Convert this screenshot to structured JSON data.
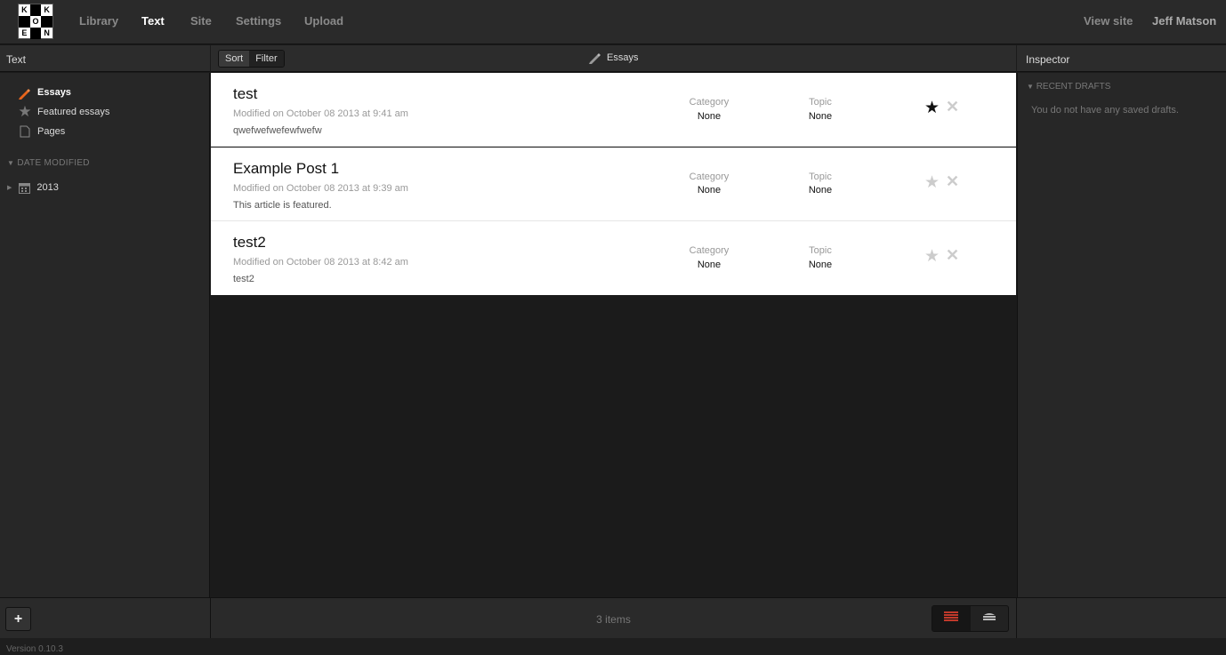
{
  "logo": {
    "letters": [
      "K",
      "",
      "K",
      "",
      "O",
      "",
      "E",
      "",
      "N"
    ]
  },
  "nav": {
    "library": "Library",
    "text": "Text",
    "site": "Site",
    "settings": "Settings",
    "upload": "Upload",
    "view_site": "View site",
    "user": "Jeff Matson"
  },
  "left_header": "Text",
  "sidebar": {
    "items": [
      {
        "label": "Essays",
        "icon": "pencil-icon"
      },
      {
        "label": "Featured essays",
        "icon": "star-icon"
      },
      {
        "label": "Pages",
        "icon": "page-icon"
      }
    ],
    "section_title": "DATE MODIFIED",
    "years": [
      {
        "label": "2013",
        "icon": "calendar-icon"
      }
    ]
  },
  "toolbar": {
    "sort": "Sort",
    "filter": "Filter",
    "current": "Essays"
  },
  "inspector": {
    "title": "Inspector",
    "section": "RECENT DRAFTS",
    "empty": "You do not have any saved drafts."
  },
  "rows": [
    {
      "title": "test",
      "modified": "Modified on October 08 2013 at 9:41 am",
      "excerpt": "qwefwefwefewfwefw",
      "category_label": "Category",
      "category": "None",
      "topic_label": "Topic",
      "topic": "None",
      "featured": true
    },
    {
      "title": "Example Post 1",
      "modified": "Modified on October 08 2013 at 9:39 am",
      "excerpt": "This article is featured.",
      "category_label": "Category",
      "category": "None",
      "topic_label": "Topic",
      "topic": "None",
      "featured": false
    },
    {
      "title": "test2",
      "modified": "Modified on October 08 2013 at 8:42 am",
      "excerpt": "test2",
      "category_label": "Category",
      "category": "None",
      "topic_label": "Topic",
      "topic": "None",
      "featured": false
    }
  ],
  "bottom": {
    "add": "+",
    "count": "3 items"
  },
  "footer": {
    "version": "Version 0.10.3"
  },
  "colors": {
    "accent": "#e8641b",
    "star_on": "#111111",
    "star_off": "#cccccc"
  }
}
